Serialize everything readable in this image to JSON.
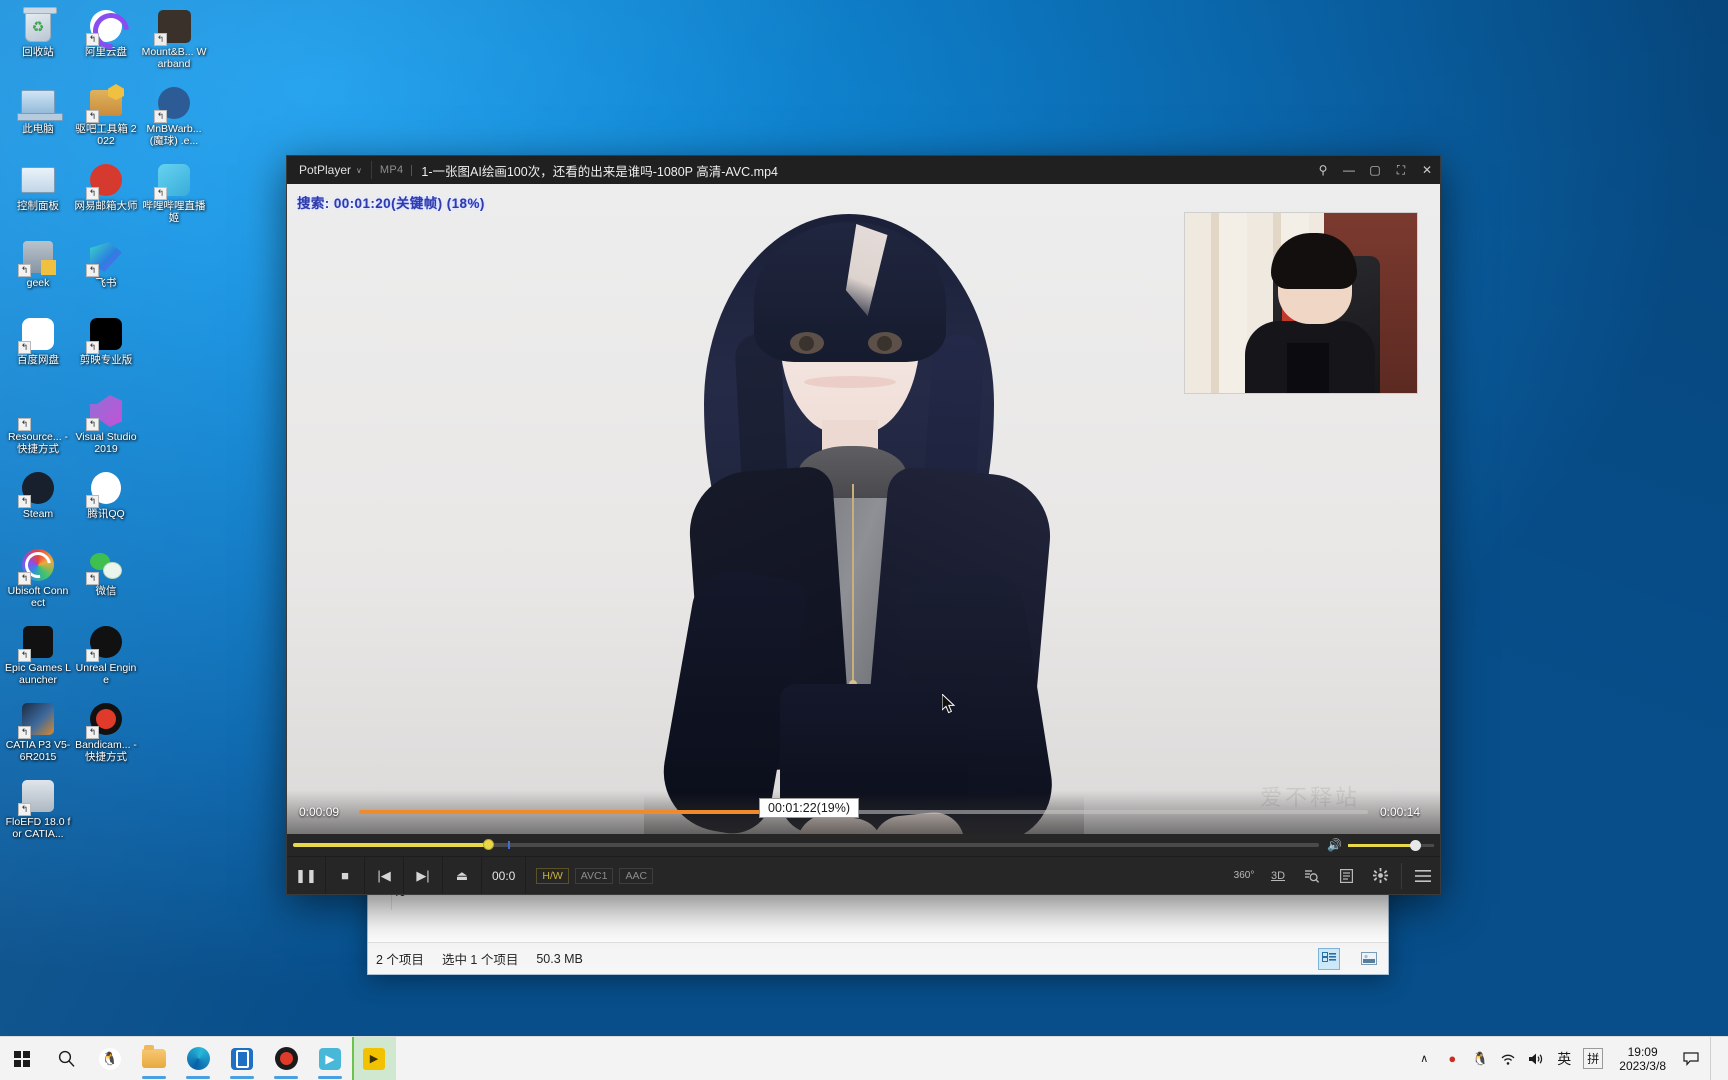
{
  "desktop": {
    "icons": [
      {
        "label": "回收站",
        "art": "ic-trash",
        "shortcut": false
      },
      {
        "label": "阿里云盘",
        "art": "ic-aliyun",
        "shortcut": true
      },
      {
        "label": "Mount&B... Warband",
        "art": "ic-horse",
        "shortcut": true
      },
      {
        "label": "此电脑",
        "art": "ic-pc",
        "shortcut": false
      },
      {
        "label": "驱吧工具箱 2022",
        "art": "ic-toolbox",
        "shortcut": true
      },
      {
        "label": "MnBWarb... (魔球) .e...",
        "art": "ic-mnb",
        "shortcut": true
      },
      {
        "label": "控制面板",
        "art": "ic-ctrl",
        "shortcut": false
      },
      {
        "label": "网易邮箱大师",
        "art": "ic-netease",
        "shortcut": true
      },
      {
        "label": "哔哩哔哩直播姬",
        "art": "ic-bili",
        "shortcut": true
      },
      {
        "label": "geek",
        "art": "ic-geek",
        "shortcut": true
      },
      {
        "label": "飞书",
        "art": "ic-feishu",
        "shortcut": true
      },
      {
        "label": "百度网盘",
        "art": "ic-baidu",
        "shortcut": true
      },
      {
        "label": "剪映专业版",
        "art": "ic-jianying",
        "shortcut": true
      },
      {
        "label": "Resource... - 快捷方式",
        "art": "ic-rh",
        "shortcut": true
      },
      {
        "label": "Visual Studio 2019",
        "art": "ic-vs",
        "shortcut": true
      },
      {
        "label": "Steam",
        "art": "ic-steam",
        "shortcut": true
      },
      {
        "label": "腾讯QQ",
        "art": "ic-qq",
        "shortcut": true
      },
      {
        "label": "Ubisoft Connect",
        "art": "ic-ubi",
        "shortcut": true
      },
      {
        "label": "微信",
        "art": "ic-wechat",
        "shortcut": true
      },
      {
        "label": "Epic Games Launcher",
        "art": "ic-epic",
        "shortcut": true
      },
      {
        "label": "Unreal Engine",
        "art": "ic-unreal",
        "shortcut": true
      },
      {
        "label": "CATIA P3 V5-6R2015",
        "art": "ic-catia",
        "shortcut": true
      },
      {
        "label": "Bandicam... - 快捷方式",
        "art": "ic-bandicam",
        "shortcut": true
      },
      {
        "label": "FloEFD 18.0 for CATIA...",
        "art": "ic-floefd",
        "shortcut": true
      }
    ]
  },
  "explorer": {
    "partial_text": "40",
    "status": {
      "item_count": "2 个项目",
      "selection": "选中 1 个项目",
      "size": "50.3 MB"
    },
    "view_buttons": [
      {
        "name": "details-view",
        "active": true
      },
      {
        "name": "large-icons-view",
        "active": false
      }
    ]
  },
  "potplayer": {
    "titlebar": {
      "app_name": "PotPlayer",
      "chevron": "∨",
      "format": "MP4",
      "title": "1-一张图AI绘画100次，还看的出来是谁吗-1080P 高清-AVC.mp4",
      "buttons": [
        {
          "name": "pin-button",
          "glyph": "⚲"
        },
        {
          "name": "minimize-button",
          "glyph": "—"
        },
        {
          "name": "maximize-button",
          "glyph": "▢"
        },
        {
          "name": "fullscreen-button",
          "glyph": "⛶"
        },
        {
          "name": "close-button",
          "glyph": "✕"
        }
      ]
    },
    "osd_message": "搜索: 00:01:20(关键帧) (18%)",
    "overlay_seek": {
      "elapsed": "0:00:09",
      "remaining": "0:00:14",
      "progress_percent": 49
    },
    "watermark": "爱不释站",
    "seek": {
      "progress_percent": 19,
      "chapter_percent": 21
    },
    "volume": {
      "level_percent": 78,
      "icon": "speaker-icon"
    },
    "transport_buttons": [
      {
        "name": "pause-button",
        "glyph": "❚❚"
      },
      {
        "name": "stop-button",
        "glyph": "■"
      },
      {
        "name": "previous-button",
        "glyph": "|◀"
      },
      {
        "name": "next-button",
        "glyph": "▶|"
      },
      {
        "name": "eject-button",
        "glyph": "⏏"
      }
    ],
    "time_display": "00:0",
    "codec_chips": [
      {
        "label": "H/W",
        "accent": true
      },
      {
        "label": "AVC1",
        "accent": false
      },
      {
        "label": "AAC",
        "accent": false
      }
    ],
    "right_buttons": [
      {
        "name": "three-sixty-button",
        "glyph": "360°"
      },
      {
        "name": "three-d-button",
        "glyph": "3D"
      },
      {
        "name": "search-button",
        "glyph": "🔍"
      },
      {
        "name": "playlist-button",
        "glyph": "▤"
      },
      {
        "name": "settings-button",
        "glyph": "✸"
      },
      {
        "name": "menu-button",
        "glyph": "☰"
      }
    ],
    "tooltip": "00:01:22(19%)"
  },
  "taskbar": {
    "items": [
      {
        "name": "start-button",
        "art": "ti-win",
        "running": false,
        "active": false
      },
      {
        "name": "search-button",
        "art": "ti-search",
        "glyph": "⌕",
        "running": false,
        "active": false
      },
      {
        "name": "taskbar-qq",
        "art": "ti-qq",
        "glyph": "🐧",
        "running": false,
        "active": false
      },
      {
        "name": "taskbar-file-explorer",
        "art": "ti-folder",
        "running": true,
        "active": false
      },
      {
        "name": "taskbar-edge",
        "art": "ti-edge",
        "running": true,
        "active": false
      },
      {
        "name": "taskbar-blue-app",
        "art": "ti-blue",
        "running": true,
        "active": false
      },
      {
        "name": "taskbar-bandicam",
        "art": "ti-band",
        "running": true,
        "active": false
      },
      {
        "name": "taskbar-teal-app",
        "art": "ti-teal",
        "glyph": "▶",
        "running": true,
        "active": false
      },
      {
        "name": "taskbar-potplayer",
        "art": "ti-pot",
        "glyph": "▶",
        "running": true,
        "active": true
      }
    ],
    "tray": {
      "chevron": "∧",
      "icons": [
        {
          "name": "recording-indicator-icon",
          "glyph": "●",
          "color": "#cc2b1d"
        },
        {
          "name": "qq-tray-icon",
          "glyph": "🐧",
          "color": "#e8a33d"
        },
        {
          "name": "wifi-icon",
          "glyph": "📶",
          "color": "#1b1b1b"
        },
        {
          "name": "volume-icon",
          "glyph": "🔊",
          "color": "#1b1b1b"
        }
      ],
      "ime_lang": "英",
      "ime_mode": "拼",
      "time": "19:09",
      "date": "2023/3/8",
      "notification_glyph": "▢"
    }
  }
}
